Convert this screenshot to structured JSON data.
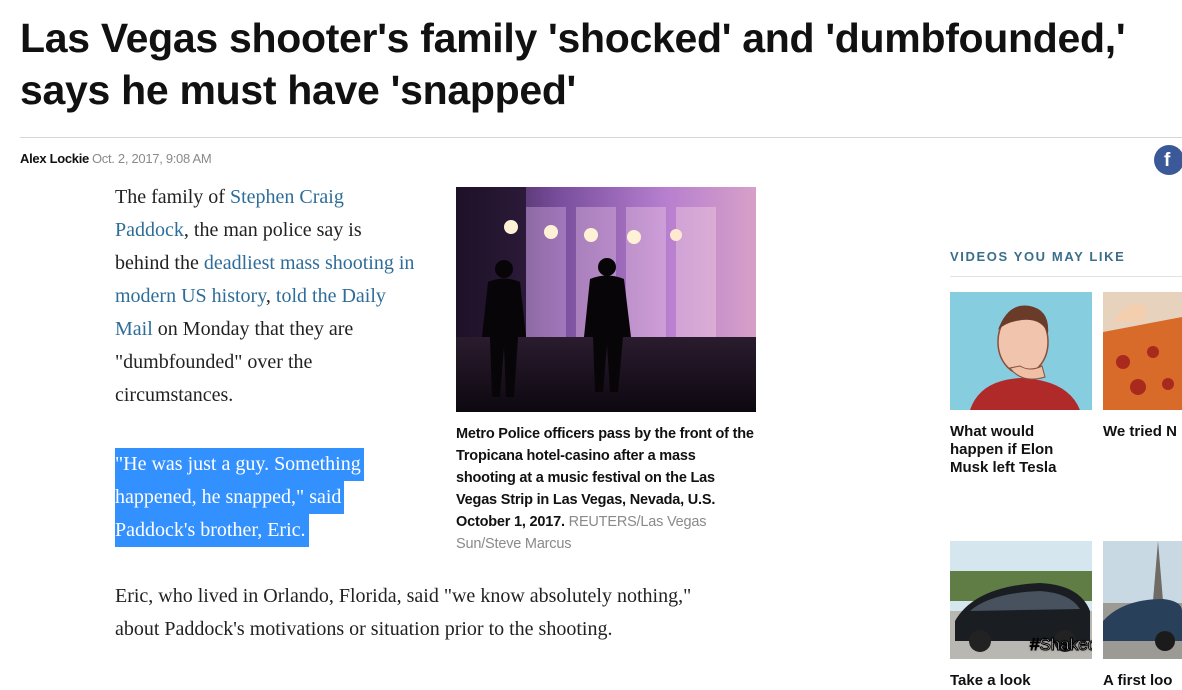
{
  "article": {
    "headline": "Las Vegas shooter's family 'shocked' and 'dumbfounded,' says he must have 'snapped'",
    "author": "Alex Lockie",
    "date": "Oct. 2, 2017, 9:08 AM"
  },
  "share": {
    "icon": "facebook-icon",
    "glyph": "f",
    "color": "#3b5998"
  },
  "paragraph1": {
    "t1": "The family of ",
    "link1": "Stephen Craig Paddock",
    "t2": ", the man police say is behind the ",
    "link2": "deadliest mass shooting in modern US history",
    "t3": ", ",
    "link3": "told the Daily Mail",
    "t4": " on Monday that they are \"dumbfounded\" over the circumstances."
  },
  "quote": {
    "line1": "\"He was just a guy. Something",
    "line2": "happened, he snapped,\" said",
    "line3": "Paddock's brother, Eric."
  },
  "paragraph3": "Eric, who lived in Orlando, Florida, said \"we know absolutely nothing,\" about Paddock's motivations or situation prior to the shooting.",
  "figure": {
    "caption": "Metro Police officers pass by the front of the Tropicana hotel-casino after a mass shooting at a music festival on the Las Vegas Strip in Las Vegas, Nevada, U.S. October 1, 2017.",
    "credit": "REUTERS/Las Vegas Sun/Steve Marcus"
  },
  "videos": {
    "title": "VIDEOS YOU MAY LIKE",
    "items": [
      {
        "title": "What would happen if Elon Musk left Tesla"
      },
      {
        "title": "We tried N pizza that thin you h roll it"
      },
      {
        "title": "Take a look",
        "overlay": "#Shakedown"
      },
      {
        "title": "A first loo"
      }
    ]
  },
  "colors": {
    "link": "#2e6d99",
    "selection": "#3390ff",
    "section_label": "#3a6e8a"
  }
}
